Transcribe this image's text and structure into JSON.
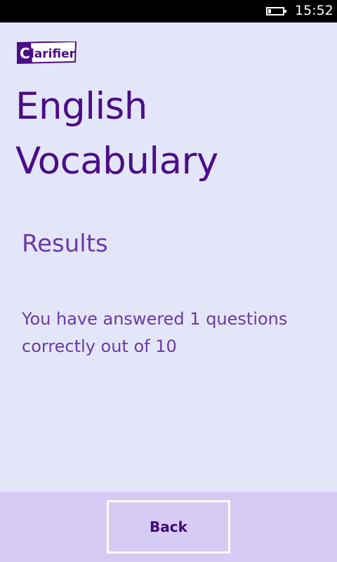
{
  "status_bar": {
    "time": "15:52",
    "battery_icon": "battery-low-icon",
    "battery_level": 0.15
  },
  "logo": {
    "text": "Clarifier",
    "brand_color": "#4b0d87"
  },
  "page": {
    "title": "English Vocabulary",
    "section_heading": "Results",
    "result_message": "You have answered 1 questions correctly out of 10"
  },
  "app_bar": {
    "back_label": "Back"
  },
  "colors": {
    "background": "#e3e6f8",
    "title": "#4b0d87",
    "text": "#6a3aa8",
    "app_bar": "#d6cbf5"
  }
}
